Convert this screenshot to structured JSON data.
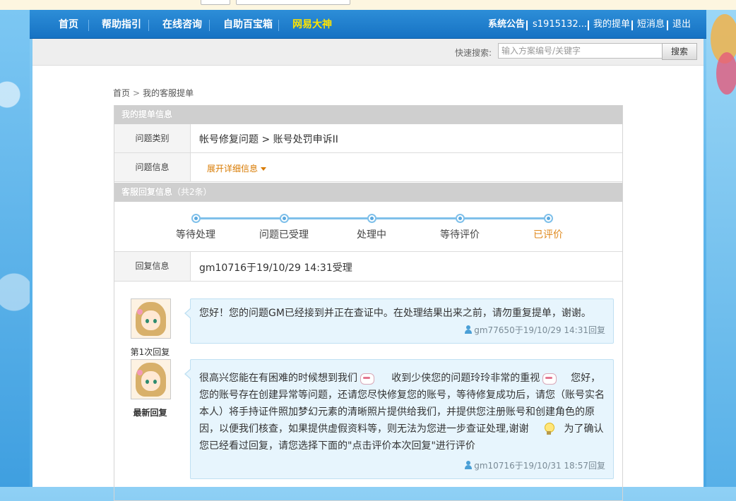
{
  "nav": {
    "items": [
      {
        "label": "首页",
        "active": false
      },
      {
        "label": "帮助指引",
        "active": false
      },
      {
        "label": "在线咨询",
        "active": false
      },
      {
        "label": "自助百宝箱",
        "active": false
      },
      {
        "label": "网易大神",
        "active": true
      }
    ],
    "right": {
      "notice": "系统公告",
      "user": "s1915132...",
      "my_tickets": "我的提单",
      "messages": "短消息",
      "logout": "退出"
    }
  },
  "search": {
    "label": "快速搜索:",
    "placeholder": "输入方案编号/关键字",
    "button": "搜索"
  },
  "breadcrumb": {
    "home": "首页",
    "separator": ">",
    "current": "我的客服提单"
  },
  "ticket_info": {
    "section_title": "我的提单信息",
    "category_label": "问题类别",
    "category_value": "帐号修复问题 > 账号处罚申诉II",
    "info_label": "问题信息",
    "expand_label": "展开详细信息"
  },
  "reply_info": {
    "section_title": "客服回复信息",
    "count_text": "（共2条）",
    "steps": [
      {
        "label": "等待处理",
        "state": "normal"
      },
      {
        "label": "问题已受理",
        "state": "normal"
      },
      {
        "label": "处理中",
        "state": "normal"
      },
      {
        "label": "等待评价",
        "state": "normal"
      },
      {
        "label": "已评价",
        "state": "done"
      }
    ],
    "reply_label": "回复信息",
    "reply_value": "gm10716于19/10/29 14:31受理"
  },
  "replies": [
    {
      "caption": "第1次回复",
      "message": "您好！您的问题GM已经接到并正在查证中。在处理结果出来之前，请勿重复提单，谢谢。",
      "meta": "gm77650于19/10/29 14:31回复"
    },
    {
      "caption": "最新回复",
      "message_part1": "很高兴您能在有困难的时候想到我们",
      "message_part2": "收到少侠您的问题玲玲非常的重视",
      "message_part3": "您好，您的账号存在创建异常等问题，还请您尽快修复您的账号，等待修复成功后，请您（账号实名本人）将手持证件照加梦幻元素的清晰照片提供给我们，并提供您注册账号和创建角色的原因，以便我们核查，如果提供虚假资料等，则无法为您进一步查证处理,谢谢",
      "message_part4": "为了确认您已经看过回复，请您选择下面的\"点击评价本次回复\"进行评价",
      "meta": "gm10716于19/10/31 18:57回复"
    }
  ],
  "colors": {
    "nav_bg": "#1672c3",
    "active_nav": "#ffe400",
    "section_head": "#cfcfcf",
    "done_step": "#e08a1e",
    "bubble_bg": "#e7f5fd"
  }
}
